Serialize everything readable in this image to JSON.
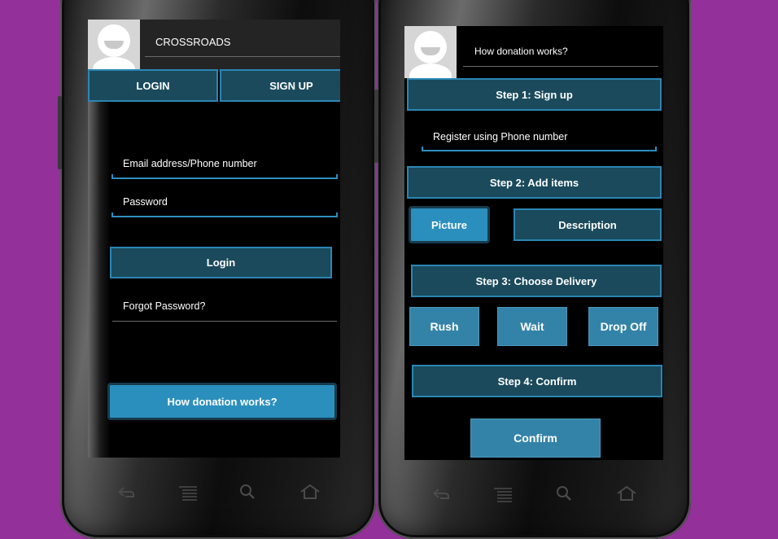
{
  "login_screen": {
    "app_title": "CROSSROADS",
    "tabs": {
      "login": "LOGIN",
      "signup": "SIGN UP"
    },
    "email_label": "Email address/Phone number",
    "password_label": "Password",
    "login_button": "Login",
    "forgot_password": "Forgot Password?",
    "how_button": "How donation works?"
  },
  "donation_screen": {
    "title": "How donation works?",
    "step1": "Step 1: Sign up",
    "register_field": "Register using Phone number",
    "step2": "Step 2: Add items",
    "picture_button": "Picture",
    "description_button": "Description",
    "step3": "Step 3: Choose Delivery",
    "rush_button": "Rush",
    "wait_button": "Wait",
    "dropoff_button": "Drop Off",
    "step4": "Step 4: Confirm",
    "confirm_button": "Confirm"
  },
  "navbar_icons": [
    "back-icon",
    "menu-icon",
    "search-icon",
    "home-icon"
  ],
  "colors": {
    "background": "#93309a",
    "button_dark": "#1a4a5c",
    "button_light": "#3383a8",
    "accent": "#2b8fbd"
  }
}
